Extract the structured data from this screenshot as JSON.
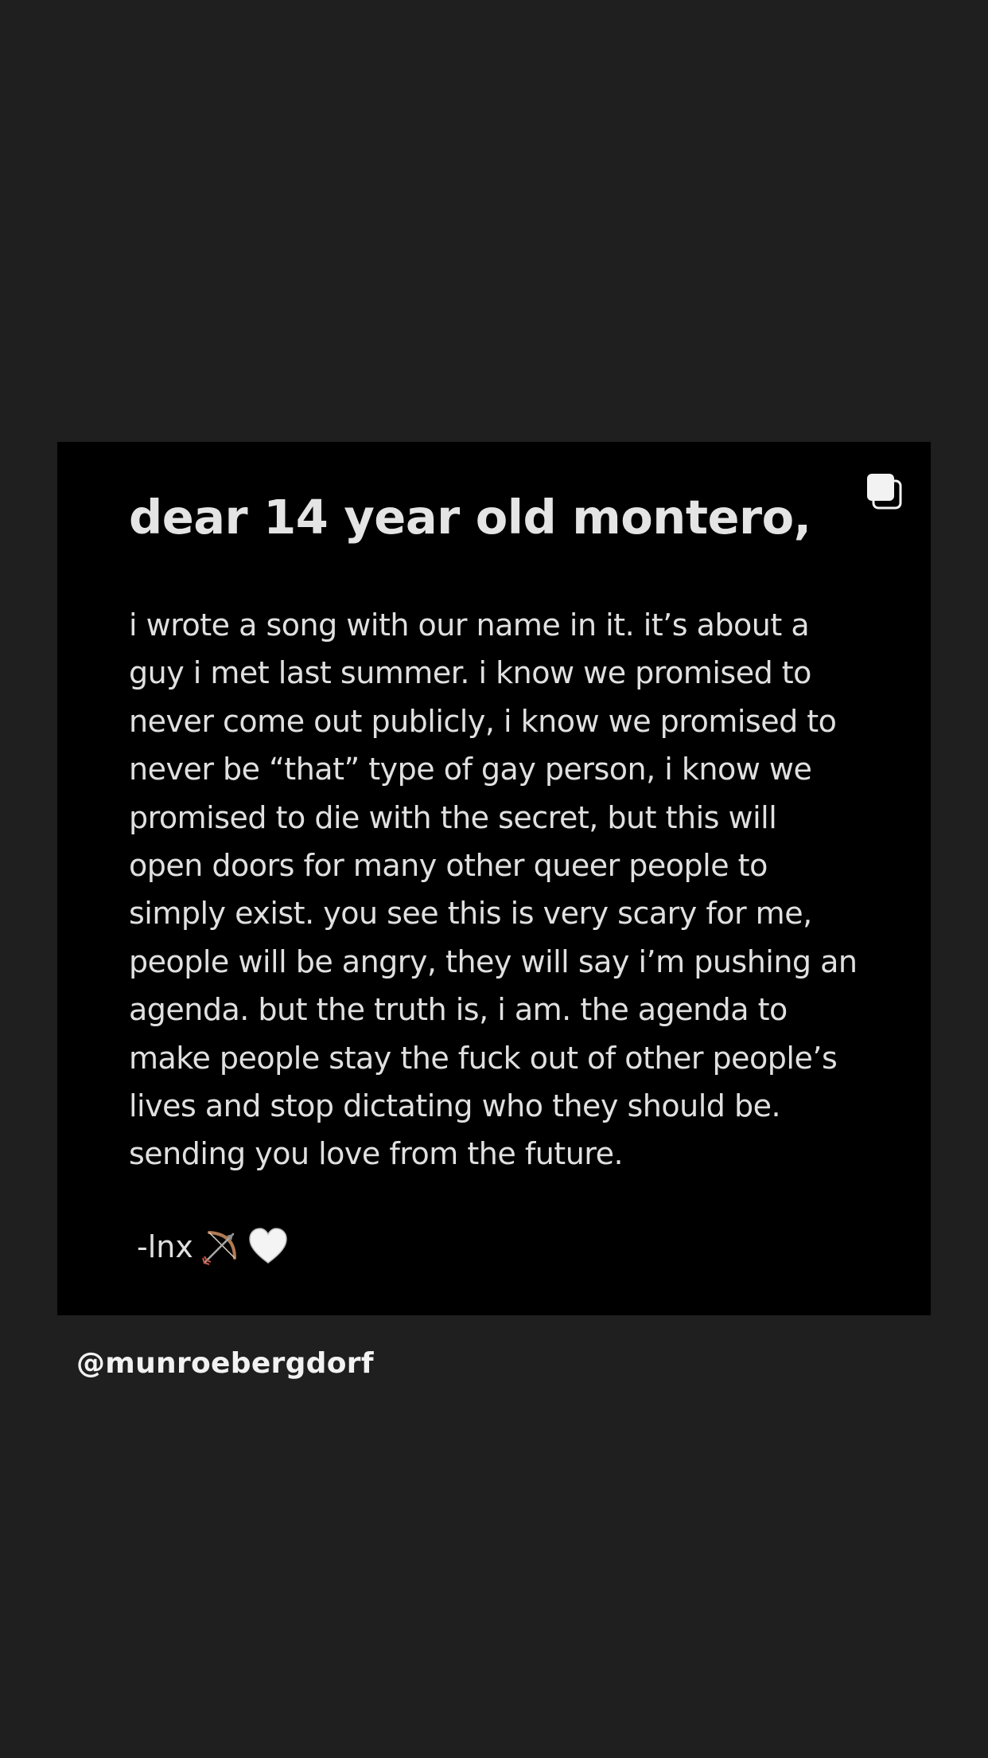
{
  "post": {
    "title": "dear 14 year old montero,",
    "body_lines": [
      "i wrote a song with our name in it. it’s about a",
      "guy i met last summer. i know we promised to",
      "never come out publicly, i know we promised to",
      "never be “that” type of gay person, i know we",
      "promised to die with the secret, but this will",
      "open doors for many other queer people to",
      "simply exist. you see this is very scary for me,",
      "people will be angry, they will say i’m pushing an",
      "agenda. but the truth is, i am. the agenda to",
      "make people stay the fuck out of other people’s",
      "lives and stop dictating who they should be.",
      "sending you love from the future."
    ],
    "signature": "-lnx",
    "signature_icons": [
      "bow-and-arrow-icon",
      "white-heart-icon"
    ],
    "corner_icon": "multiple-posts-icon"
  },
  "story": {
    "mention": "@munroebergdorf"
  },
  "colors": {
    "background": "#1f1f1f",
    "card": "#000000",
    "text": "#e0e0e0"
  }
}
